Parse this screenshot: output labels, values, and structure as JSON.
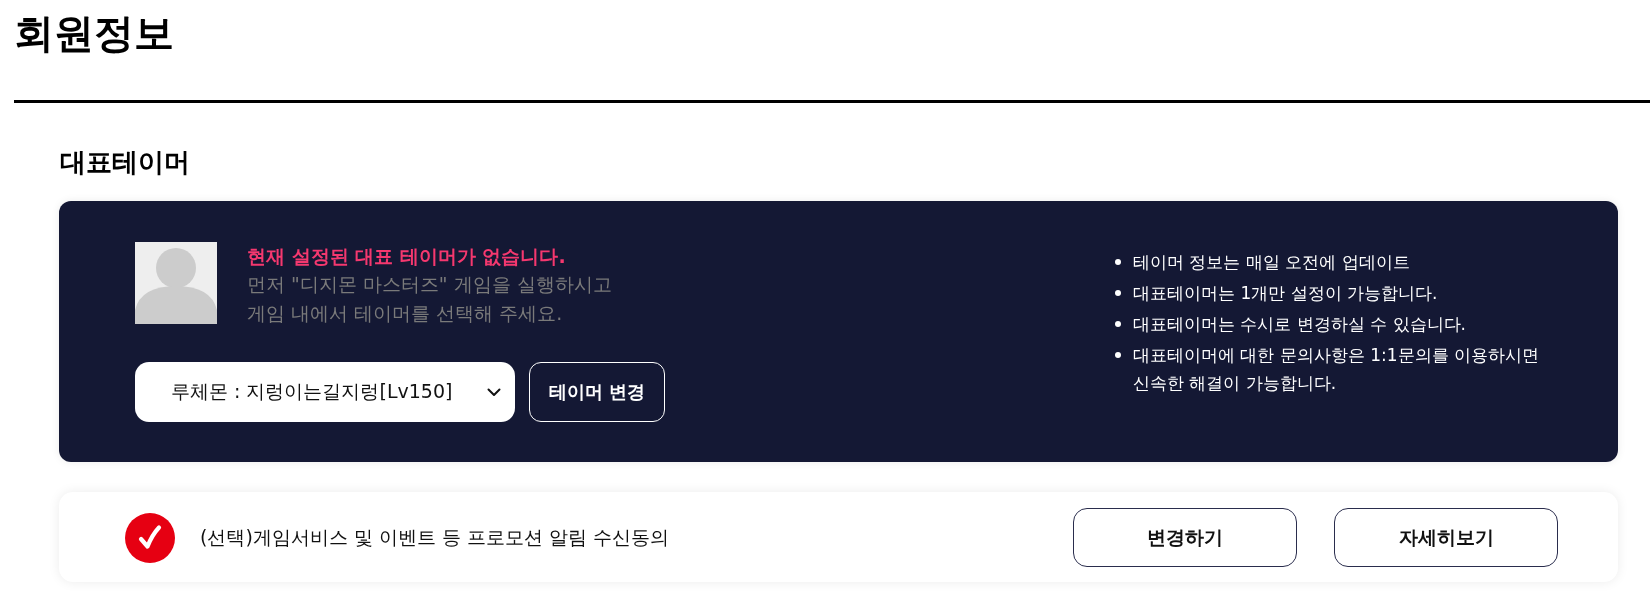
{
  "page": {
    "title": "회원정보"
  },
  "representative_tamer": {
    "heading": "대표테이머",
    "notice": {
      "title": "현재 설정된 대표 테이머가 없습니다.",
      "description": "먼저 \"디지몬 마스터즈\" 게임을 실행하시고\n게임 내에서 테이머를 선택해 주세요."
    },
    "tamer_select": {
      "value": "루체몬 : 지렁이는길지렁[Lv150]"
    },
    "change_button": "테이머 변경",
    "info_list": [
      "테이머 정보는 매일 오전에 업데이트",
      "대표테이머는 1개만 설정이 가능합니다.",
      "대표테이머는 수시로 변경하실 수 있습니다.",
      "대표테이머에 대한 문의사항은 1:1문의를 이용하시면 신속한 해결이 가능합니다."
    ]
  },
  "marketing_consent": {
    "label": "(선택)게임서비스 및 이벤트 등 프로모션 알림 수신동의",
    "checked": true,
    "buttons": [
      "변경하기",
      "자세히보기"
    ]
  }
}
